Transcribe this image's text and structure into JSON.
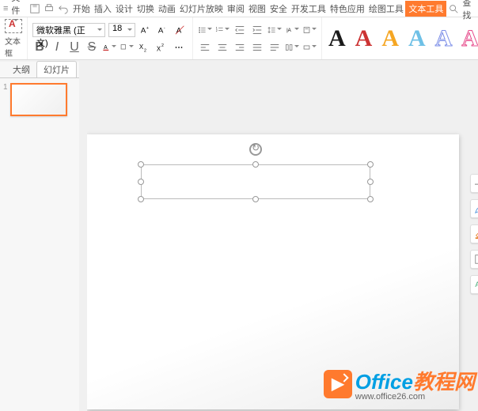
{
  "menu": {
    "hamburger": "≡",
    "file": "文件",
    "tabs": [
      "开始",
      "插入",
      "设计",
      "切换",
      "动画",
      "幻灯片放映",
      "审阅",
      "视图",
      "安全",
      "开发工具",
      "特色应用",
      "绘图工具",
      "文本工具"
    ],
    "active_tab_index": 12,
    "search": "查找"
  },
  "ribbon": {
    "textbox_caption": "文本框",
    "font_name": "微软雅黑 (正文)",
    "font_size": "18",
    "format_labels": {
      "bold": "B",
      "italic": "I",
      "underline": "U",
      "strike": "S"
    },
    "wordart_colors": [
      "#1a1a1a",
      "#c33",
      "#f5a623",
      "#6ec0e6",
      "#7d8fe8",
      "#e74c8c"
    ]
  },
  "leftpanel": {
    "tab_outline": "大纲",
    "tab_slides": "幻灯片",
    "slides": [
      {
        "index": "1"
      }
    ]
  },
  "float_tools": {
    "minimize": "—",
    "pen": "pen-icon",
    "fill": "fill-icon",
    "frame": "frame-icon",
    "textstyle": "A≡"
  },
  "watermark": {
    "brand1": "Office",
    "brand2": "教程网",
    "url": "www.office26.com",
    "badge": "▶"
  }
}
